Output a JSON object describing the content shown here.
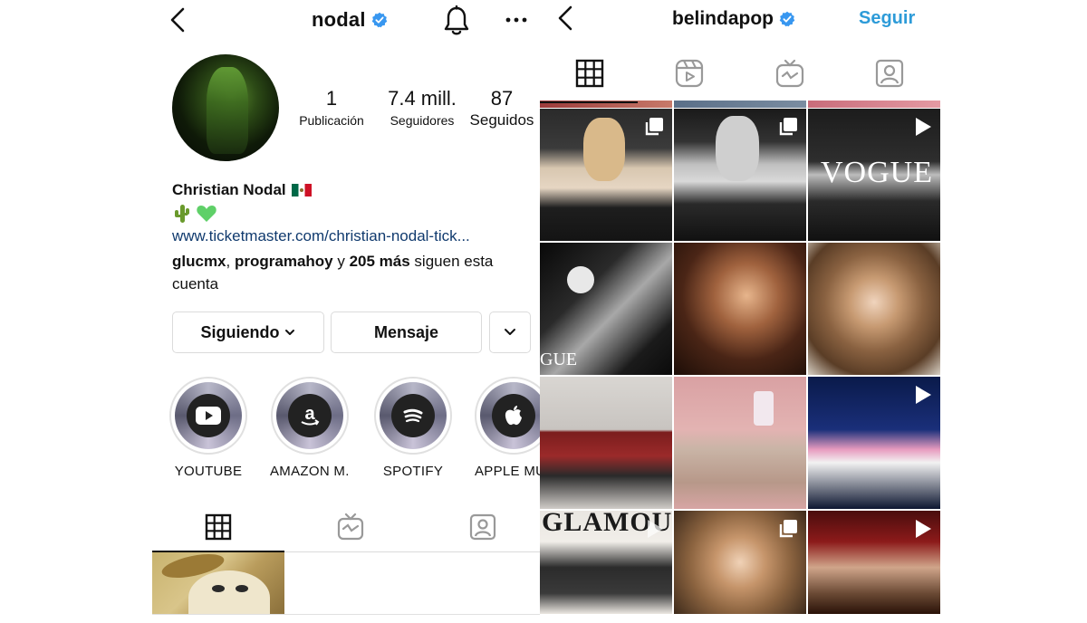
{
  "left": {
    "username": "nodal",
    "stats": {
      "posts_count": "1",
      "posts_label": "Publicación",
      "followers_count": "7.4 mill.",
      "followers_label": "Seguidores",
      "following_count": "87",
      "following_label": "Seguidos"
    },
    "full_name": "Christian Nodal",
    "bio_emoji": "🌵💚",
    "link": "www.ticketmaster.com/christian-nodal-tick...",
    "followed_by": {
      "user1": "glucmx",
      "separator": ", ",
      "user2": "programahoy",
      "middle": " y ",
      "more": "205 más",
      "suffix": " siguen esta cuenta"
    },
    "buttons": {
      "following_label": "Siguiendo",
      "message_label": "Mensaje"
    },
    "highlights": [
      {
        "label": "YOUTUBE",
        "icon": "youtube-icon"
      },
      {
        "label": "AMAZON M...",
        "icon": "amazon-icon"
      },
      {
        "label": "SPOTIFY",
        "icon": "spotify-icon"
      },
      {
        "label": "APPLE MU",
        "icon": "apple-icon"
      }
    ]
  },
  "right": {
    "username": "belindapop",
    "follow_label": "Seguir",
    "follow_color": "#2d9bd8",
    "grid_cells": [
      {
        "badge": "carousel-icon"
      },
      {
        "badge": "carousel-icon"
      },
      {
        "badge": "reel-icon",
        "text": "VOGUE"
      },
      {
        "badge": "",
        "text": "GUE"
      },
      {
        "badge": ""
      },
      {
        "badge": ""
      },
      {
        "badge": ""
      },
      {
        "badge": ""
      },
      {
        "badge": "reel-icon"
      },
      {
        "badge": "",
        "text": "GLAMOUR"
      },
      {
        "badge": "carousel-icon"
      },
      {
        "badge": "reel-icon"
      }
    ]
  },
  "colors": {
    "verified": "#3897f0",
    "link": "#103a6e",
    "border": "#dbdbdb"
  }
}
